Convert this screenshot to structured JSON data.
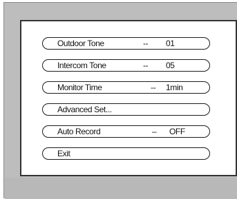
{
  "menu": {
    "items": [
      {
        "label": "Outdoor Tone",
        "separator": "--",
        "value": "01"
      },
      {
        "label": "Intercom Tone",
        "separator": "--",
        "value": "05"
      },
      {
        "label": "Monitor Time",
        "separator": "--",
        "value": "1min"
      },
      {
        "label": "Advanced Set...",
        "separator": "",
        "value": ""
      },
      {
        "label": "Auto Record",
        "separator": "–",
        "value": "OFF"
      },
      {
        "label": "Exit",
        "separator": "",
        "value": ""
      }
    ]
  },
  "colors": {
    "frame": "#bdbdbd",
    "screen": "#ffffff",
    "outline": "#1a1a1a"
  }
}
